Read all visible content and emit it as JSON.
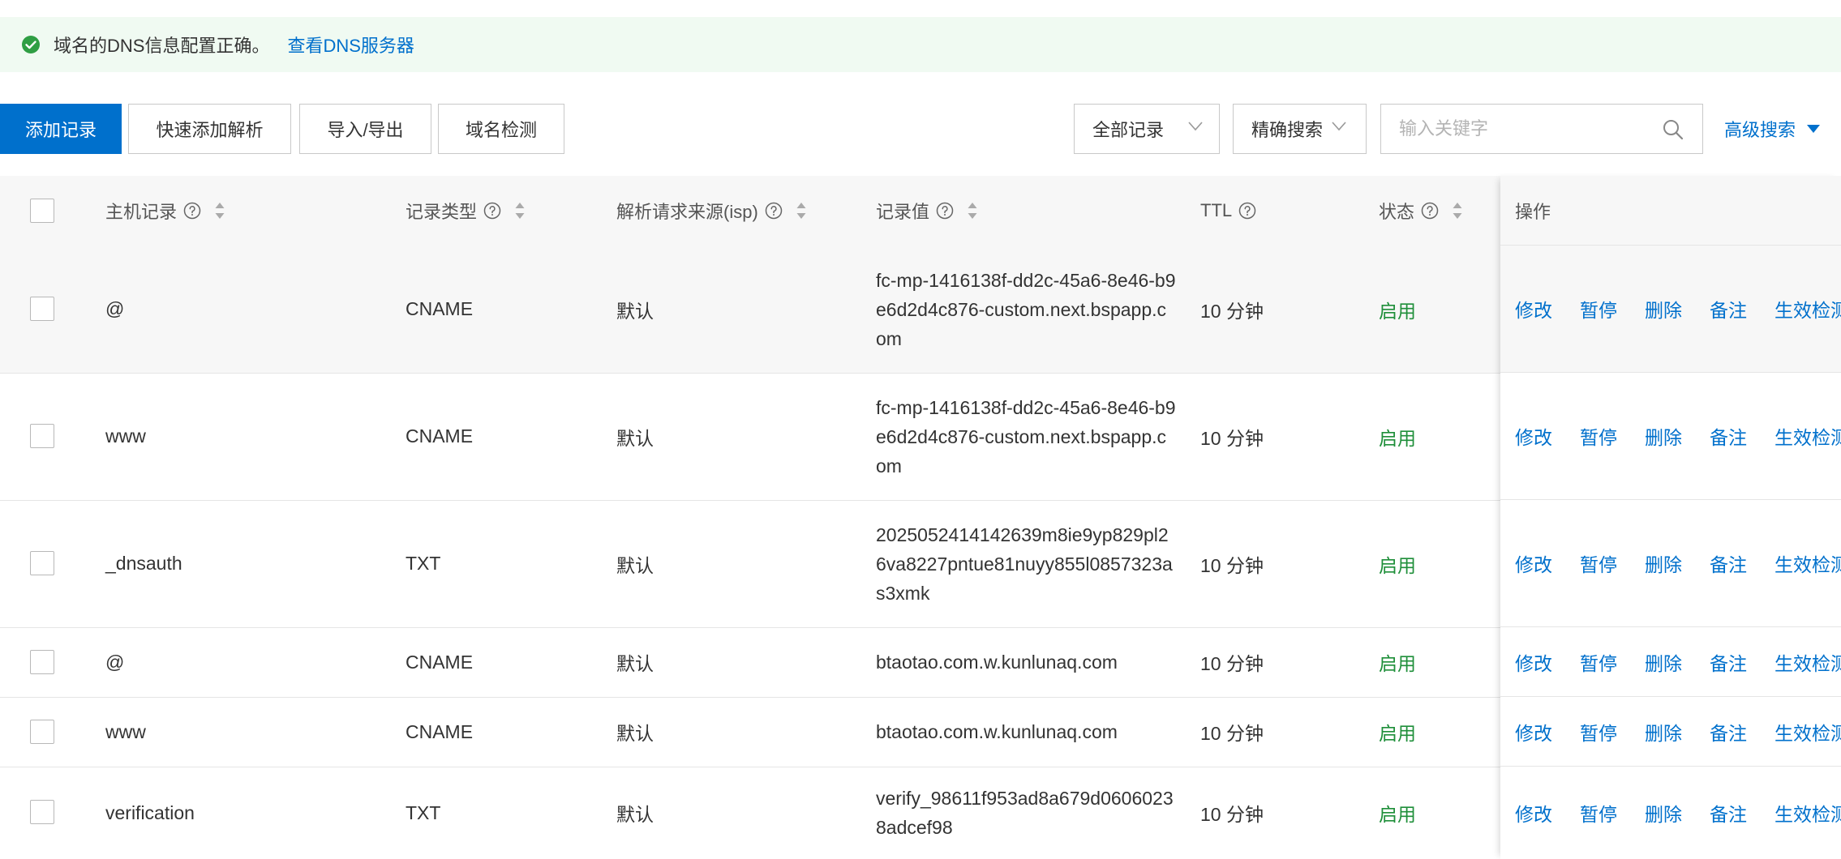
{
  "banner": {
    "message": "域名的DNS信息配置正确。",
    "link": "查看DNS服务器",
    "icon": "check-circle-icon",
    "color": "#2f9e44"
  },
  "toolbar": {
    "add": "添加记录",
    "quick_add": "快速添加解析",
    "import_export": "导入/导出",
    "check": "域名检测",
    "filter_select": "全部记录",
    "search_mode": "精确搜索",
    "search_placeholder": "输入关键字",
    "advanced": "高级搜索"
  },
  "table": {
    "columns": {
      "host": "主机记录",
      "type": "记录类型",
      "isp": "解析请求来源(isp)",
      "value": "记录值",
      "ttl": "TTL",
      "status": "状态",
      "ops": "操作"
    },
    "rows": [
      {
        "host": "@",
        "type": "CNAME",
        "isp": "默认",
        "value": "fc-mp-1416138f-dd2c-45a6-8e46-b9e6d2d4c876-custom.next.bspapp.com",
        "ttl": "10 分钟",
        "status": "启用"
      },
      {
        "host": "www",
        "type": "CNAME",
        "isp": "默认",
        "value": "fc-mp-1416138f-dd2c-45a6-8e46-b9e6d2d4c876-custom.next.bspapp.com",
        "ttl": "10 分钟",
        "status": "启用"
      },
      {
        "host": "_dnsauth",
        "type": "TXT",
        "isp": "默认",
        "value": "2025052414142639m8ie9yp829pl26va8227pntue81nuyy855l0857323as3xmk",
        "ttl": "10 分钟",
        "status": "启用"
      },
      {
        "host": "@",
        "type": "CNAME",
        "isp": "默认",
        "value": "btaotao.com.w.kunlunaq.com",
        "ttl": "10 分钟",
        "status": "启用"
      },
      {
        "host": "www",
        "type": "CNAME",
        "isp": "默认",
        "value": "btaotao.com.w.kunlunaq.com",
        "ttl": "10 分钟",
        "status": "启用"
      },
      {
        "host": "verification",
        "type": "TXT",
        "isp": "默认",
        "value": "verify_98611f953ad8a679d06060238adcef98",
        "ttl": "10 分钟",
        "status": "启用"
      }
    ],
    "actions": [
      "修改",
      "暂停",
      "删除",
      "备注",
      "生效检测"
    ]
  },
  "colors": {
    "accent": "#0070cc",
    "status_on": "#1f8f3a",
    "banner_bg": "#f0faf2"
  }
}
